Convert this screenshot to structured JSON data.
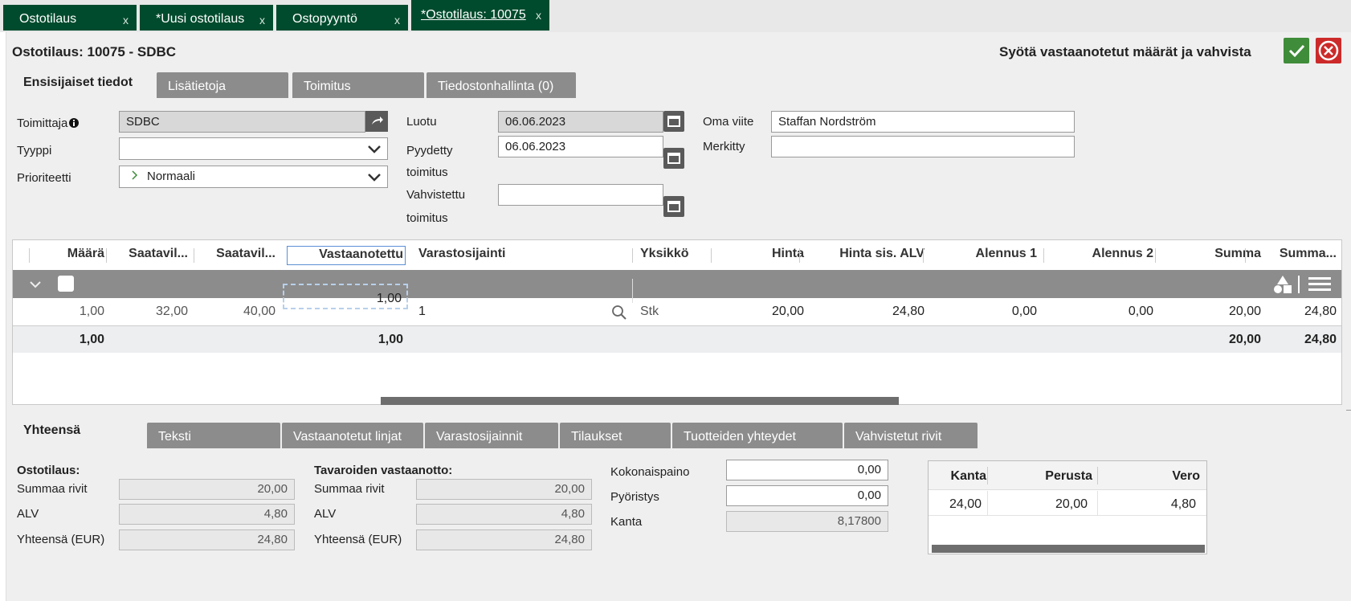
{
  "top_tabs": [
    {
      "label": "Ostotilaus",
      "close": "x"
    },
    {
      "label": "*Uusi ostotilaus",
      "close": "x"
    },
    {
      "label": "Ostopyyntö",
      "close": "x"
    },
    {
      "label": "*Ostotilaus: 10075",
      "close": "x"
    }
  ],
  "header": {
    "title": "Ostotilaus: 10075 - SDBC",
    "hint": "Syötä vastaanotetut määrät ja vahvista",
    "confirm_icon": "check-icon",
    "cancel_icon": "close-circle-icon"
  },
  "detail_tabs": [
    "Ensisijaiset tiedot",
    "Lisätietoja",
    "Toimitus",
    "Tiedostonhallinta (0)"
  ],
  "form": {
    "supplier_label": "Toimittaja",
    "supplier_value": "SDBC",
    "type_label": "Tyyppi",
    "type_value": "",
    "priority_label": "Prioriteetti",
    "priority_value": "Normaali",
    "created_label": "Luotu",
    "created_value": "06.06.2023",
    "requested_label_1": "Pyydetty",
    "requested_label_2": "toimitus",
    "requested_value": "06.06.2023",
    "confirmed_label_1": "Vahvistettu",
    "confirmed_label_2": "toimitus",
    "confirmed_value": "",
    "own_ref_label": "Oma viite",
    "own_ref_value": "Staffan Nordström",
    "marked_label": "Merkitty",
    "marked_value": ""
  },
  "grid": {
    "headers": [
      "Määrä",
      "Saatavil...",
      "Saatavil...",
      "Vastaanotettu",
      "Varastosijainti",
      "Yksikkö",
      "Hinta",
      "Hinta sis. ALV",
      "Alennus 1",
      "Alennus 2",
      "Summa",
      "Summa..."
    ],
    "row": [
      "1,00",
      "32,00",
      "40,00",
      "1,00",
      "1",
      "Stk",
      "20,00",
      "24,80",
      "0,00",
      "0,00",
      "20,00",
      "24,80"
    ],
    "totals": {
      "maara": "1,00",
      "vastaanotettu": "1,00",
      "summa": "20,00",
      "summa_alv": "24,80"
    }
  },
  "bottom_tabs": [
    "Yhteensä",
    "Teksti",
    "Vastaanotetut linjat",
    "Varastosijainnit",
    "Tilaukset",
    "Tuotteiden yhteydet",
    "Vahvistetut rivit"
  ],
  "order_totals": {
    "heading": "Ostotilaus:",
    "rows_label": "Summaa rivit",
    "rows_value": "20,00",
    "vat_label": "ALV",
    "vat_value": "4,80",
    "total_label": "Yhteensä (EUR)",
    "total_value": "24,80"
  },
  "receipt_totals": {
    "heading": "Tavaroiden vastaanotto:",
    "rows_label": "Summaa rivit",
    "rows_value": "20,00",
    "vat_label": "ALV",
    "vat_value": "4,80",
    "total_label": "Yhteensä (EUR)",
    "total_value": "24,80"
  },
  "misc": {
    "weight_label": "Kokonaispaino",
    "weight_value": "0,00",
    "rounding_label": "Pyöristys",
    "rounding_value": "0,00",
    "rate_label": "Kanta",
    "rate_value": "8,17800"
  },
  "tax_table": {
    "headers": [
      "Kanta",
      "Perusta",
      "Vero"
    ],
    "row": [
      "24,00",
      "20,00",
      "4,80"
    ]
  },
  "colors": {
    "tab_green": "#004b2d",
    "confirm_green": "#3f8c3a",
    "cancel_red": "#cc2a2a",
    "grey_bar": "#8c8c8c"
  }
}
